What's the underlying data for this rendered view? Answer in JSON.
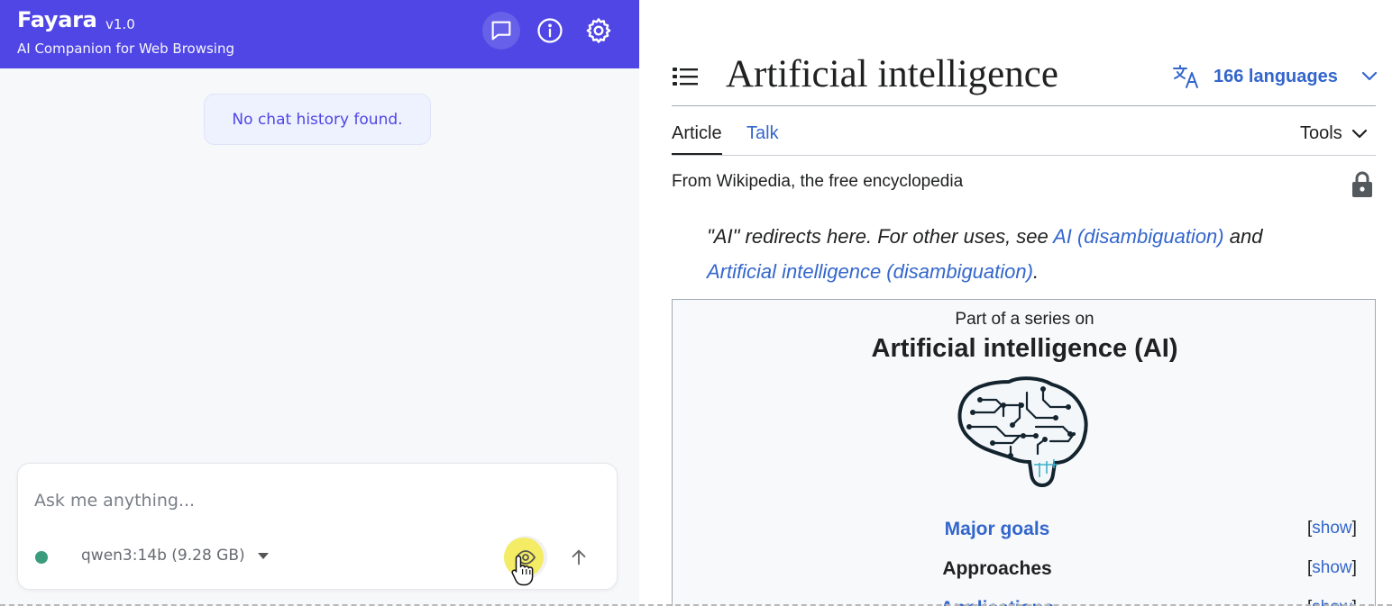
{
  "panel": {
    "app_name": "Fayara",
    "version": "v1.0",
    "subtitle": "AI Companion for Web Browsing",
    "header_icons": [
      "chat-bubble-icon",
      "info-icon",
      "gear-icon"
    ],
    "empty_message": "No chat history found.",
    "input_placeholder": "Ask me anything...",
    "model": "qwen3:14b (9.28 GB)",
    "status_color": "#3b9b7d",
    "accent_color": "#4f46e5"
  },
  "wiki": {
    "title": "Artificial intelligence",
    "languages": "166 languages",
    "tabs": [
      "Article",
      "Talk"
    ],
    "tools": "Tools",
    "tagline": "From Wikipedia, the free encyclopedia",
    "hatnote": {
      "pre": "\"AI\" redirects here. For other uses, see ",
      "link1": "AI (disambiguation)",
      "mid": " and ",
      "link2": "Artificial intelligence (disambiguation)",
      "post": "."
    },
    "infobox": {
      "pre_title": "Part of a series on",
      "title": "Artificial intelligence (AI)",
      "rows": [
        {
          "label": "Major goals",
          "toggle": "show"
        },
        {
          "label": "Approaches",
          "toggle": "show"
        },
        {
          "label": "Applications",
          "toggle": "show"
        }
      ]
    },
    "link_color": "#3366cc"
  }
}
